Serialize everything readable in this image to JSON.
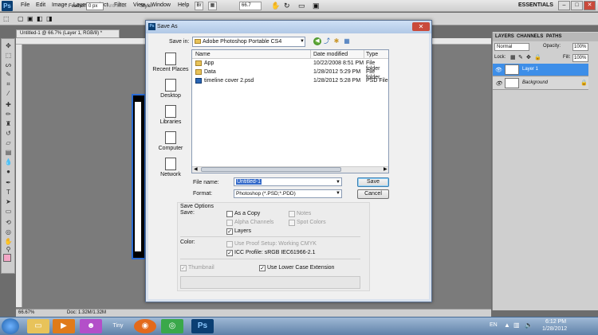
{
  "photoshop": {
    "logo": "Ps",
    "menus": [
      "File",
      "Edit",
      "Image",
      "Layer",
      "Select",
      "Filter",
      "View",
      "Window",
      "Help"
    ],
    "zoom": "66.7",
    "workspace": "ESSENTIALS",
    "options": {
      "feather_label": "Feather:",
      "feather_value": "0 px",
      "antialias_label": "Anti-alias",
      "style_label": "Style:"
    },
    "doc_tab": "Untitled-1 @ 66.7% (Layer 1, RGB/8) *",
    "status": {
      "zoom": "66.67%",
      "doc": "Doc: 1.32M/1.32M"
    }
  },
  "layers_panel": {
    "tabs": [
      "LAYERS",
      "CHANNELS",
      "PATHS"
    ],
    "blend_mode": "Normal",
    "opacity_label": "Opacity:",
    "opacity": "100%",
    "lock_label": "Lock:",
    "fill_label": "Fill:",
    "fill": "100%",
    "layers": [
      "Layer 1",
      "Background"
    ]
  },
  "dialog": {
    "title": "Save As",
    "close": "✕",
    "save_in_label": "Save in:",
    "save_in_value": "Adobe Photoshop Portable CS4",
    "places": [
      "Recent Places",
      "Desktop",
      "Libraries",
      "Computer",
      "Network"
    ],
    "columns": [
      "Name",
      "Date modified",
      "Type"
    ],
    "files": [
      {
        "name": "App",
        "date": "10/22/2008 8:51 PM",
        "type": "File folder"
      },
      {
        "name": "Data",
        "date": "1/28/2012 5:29 PM",
        "type": "File folder"
      },
      {
        "name": "timeline cover 2.psd",
        "date": "1/28/2012 5:28 PM",
        "type": "PSD File"
      }
    ],
    "file_name_label": "File name:",
    "file_name_value": "Untitled-1",
    "format_label": "Format:",
    "format_value": "Photoshop (*.PSD;*.PDD)",
    "save_button": "Save",
    "cancel_button": "Cancel",
    "save_options": {
      "header": "Save Options",
      "save_label": "Save:",
      "as_a_copy": "As a Copy",
      "notes": "Notes",
      "alpha_channels": "Alpha Channels",
      "spot_colors": "Spot Colors",
      "layers": "Layers",
      "color_label": "Color:",
      "use_proof_setup": "Use Proof Setup:  Working CMYK",
      "icc_profile": "ICC Profile:  sRGB IEC61966-2.1",
      "thumbnail": "Thumbnail",
      "lower_case": "Use Lower Case Extension"
    }
  },
  "taskbar": {
    "language": "EN",
    "time": "6:12 PM",
    "date": "1/28/2012"
  }
}
